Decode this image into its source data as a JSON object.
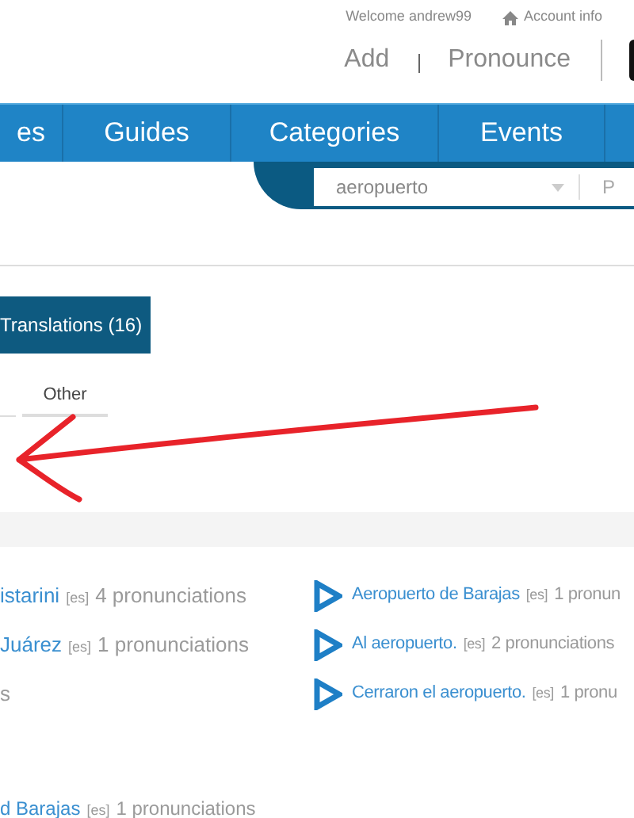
{
  "header": {
    "welcome": "Welcome andrew99",
    "account_link": "Account info",
    "actions": [
      "Add",
      "Pronounce"
    ]
  },
  "nav": {
    "items": [
      {
        "label": "es",
        "selected": false
      },
      {
        "label": "Guides",
        "selected": false
      },
      {
        "label": "Categories",
        "selected": false
      },
      {
        "label": "Events",
        "selected": false
      }
    ]
  },
  "search": {
    "value": "aeropuerto",
    "placeholder": "P"
  },
  "translations_button": "Translations (16)",
  "tabs": [
    {
      "label": "Other",
      "selected": false
    }
  ],
  "results": {
    "left": [
      {
        "title": "istarini",
        "lang": "[es]",
        "count": "4 pronunciations"
      },
      {
        "title": "Juárez",
        "lang": "[es]",
        "count": "1 pronunciations"
      },
      {
        "count": "s"
      }
    ],
    "right": [
      {
        "title": "Aeropuerto de Barajas",
        "lang": "[es]",
        "count": "1 pronun"
      },
      {
        "title": "Al aeropuerto.",
        "lang": "[es]",
        "count": "2 pronunciations"
      },
      {
        "title": "Cerraron el aeropuerto.",
        "lang": "[es]",
        "count": "1 pronu"
      }
    ],
    "bottom": [
      {
        "title": "d Barajas",
        "lang": "[es]",
        "count": "1 pronunciations"
      }
    ]
  }
}
